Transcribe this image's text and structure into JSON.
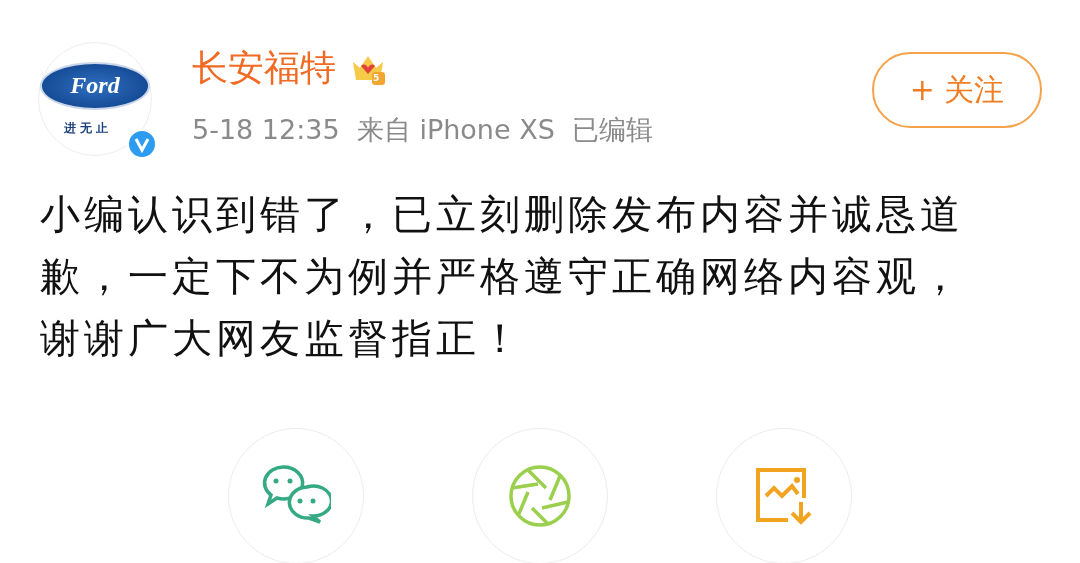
{
  "post": {
    "avatar": {
      "logo_text": "Ford",
      "slogan": "进无止",
      "verified": true
    },
    "author": "长安福特",
    "member_level": "5",
    "meta": "5-18 12:35  来自 iPhone XS  已编辑",
    "follow_button": "+ 关注",
    "text_lines": [
      "小编认识到错了，已立刻删除发布内容并诚恳道",
      "歉，一定下不为例并严格遵守正确网络内容观，",
      "谢谢广大网友监督指正！"
    ]
  },
  "share_actions": [
    {
      "kind": "chat"
    },
    {
      "kind": "moments"
    },
    {
      "kind": "save-image"
    }
  ]
}
